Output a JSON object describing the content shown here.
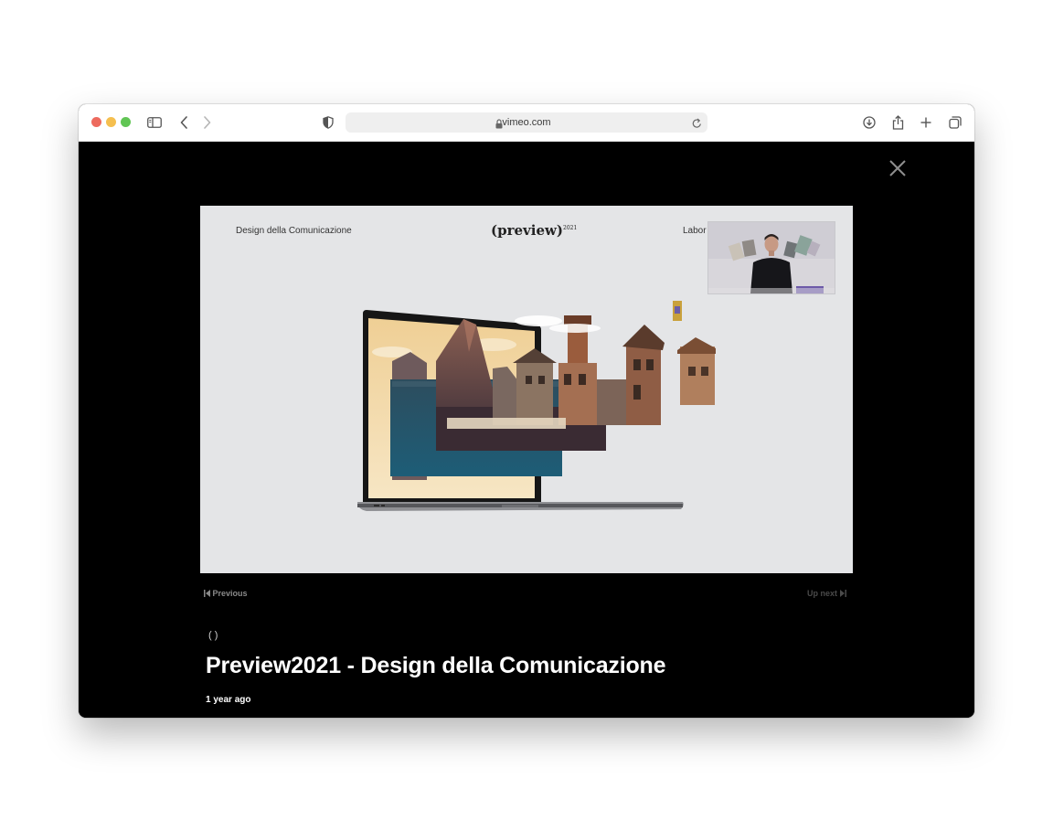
{
  "browser": {
    "url": "vimeo.com"
  },
  "video": {
    "slide_left_text": "Design della Comunicazione",
    "slide_logo": "(preview)",
    "slide_logo_sup": "2021",
    "slide_right_text": "Labor"
  },
  "nav": {
    "previous_label": "Previous",
    "next_label": "Up next"
  },
  "meta": {
    "paren_mark": "( )",
    "title": "Preview2021 - Design della Comunicazione",
    "posted": "1 year ago"
  },
  "colors": {
    "traffic_red": "#ed6a5e",
    "traffic_yellow": "#f5bf4f",
    "traffic_green": "#61c554",
    "page_background": "#000000",
    "slide_background": "#e4e5e7"
  },
  "icons": [
    "sidebar-icon",
    "back-chevron-icon",
    "forward-chevron-icon",
    "shield-icon",
    "lock-icon",
    "reload-icon",
    "download-icon",
    "share-icon",
    "plus-icon",
    "tabs-icon",
    "close-icon",
    "skip-back-icon",
    "skip-forward-icon"
  ]
}
